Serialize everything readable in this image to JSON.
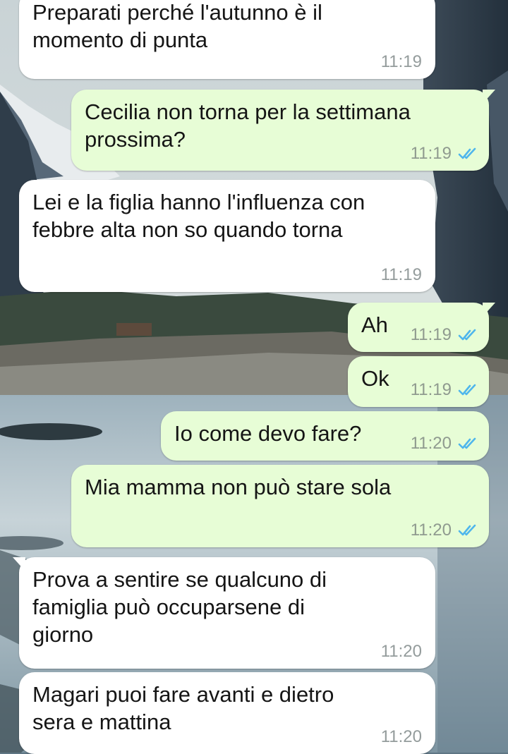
{
  "messages": [
    {
      "direction": "in",
      "text": "Preparati perché l'autunno è il\nmomento di punta",
      "time": "11:19"
    },
    {
      "direction": "out",
      "text": "Cecilia non torna per la settimana\nprossima?",
      "time": "11:19",
      "status": "read"
    },
    {
      "direction": "in",
      "text": "Lei e la figlia hanno l'influenza con\nfebbre alta non so quando torna",
      "time": "11:19"
    },
    {
      "direction": "out",
      "text": "Ah",
      "time": "11:19",
      "status": "read"
    },
    {
      "direction": "out",
      "text": "Ok",
      "time": "11:19",
      "status": "read"
    },
    {
      "direction": "out",
      "text": "Io come devo fare?",
      "time": "11:20",
      "status": "read"
    },
    {
      "direction": "out",
      "text": "Mia mamma non può stare sola",
      "time": "11:20",
      "status": "read"
    },
    {
      "direction": "in",
      "text": "Prova a sentire se qualcuno di\nfamiglia può occuparsene di\ngiorno",
      "time": "11:20"
    },
    {
      "direction": "in",
      "text": "Magari puoi fare avanti e dietro\nsera e mattina",
      "time": "11:20"
    }
  ],
  "colors": {
    "incoming_bubble": "#ffffff",
    "outgoing_bubble": "#e7fdd6",
    "read_ticks": "#4fb6ec",
    "timestamp": "#949c9c"
  },
  "icons": {
    "read_receipt": "double-check-icon"
  }
}
